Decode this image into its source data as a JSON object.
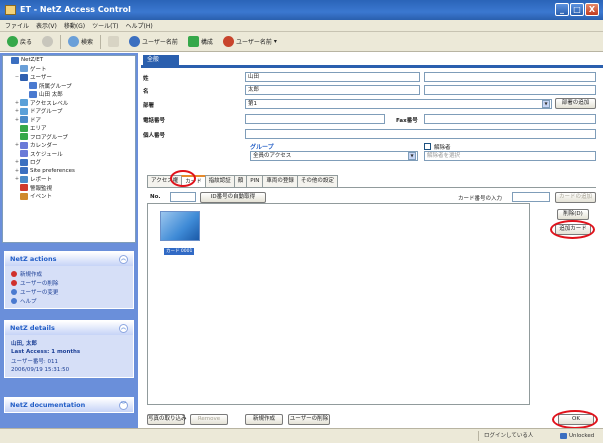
{
  "window": {
    "title": "ET - NetZ Access Control",
    "minimize": "_",
    "maximize": "□",
    "close": "X"
  },
  "menu": [
    "ファイル",
    "表示(V)",
    "移動(G)",
    "ツール(T)",
    "ヘルプ(H)"
  ],
  "toolbar": {
    "back": "戻る",
    "search": "検索",
    "users": "ユーザー名前",
    "members": "構成",
    "user_list": "ユーザー名前"
  },
  "tree": [
    {
      "level": 0,
      "exp": "",
      "icon": "#3b6fc0",
      "label": "NetZ/ET"
    },
    {
      "level": 1,
      "exp": "",
      "icon": "#6a9fd8",
      "label": "ゲート"
    },
    {
      "level": 1,
      "exp": "−",
      "icon": "#2e5fb0",
      "label": "ユーザー"
    },
    {
      "level": 2,
      "exp": "",
      "icon": "#4a7ad0",
      "label": "所属グループ"
    },
    {
      "level": 2,
      "exp": "",
      "icon": "#4a7ad0",
      "label": "山田 太郎"
    },
    {
      "level": 1,
      "exp": "+",
      "icon": "#5aa0d8",
      "label": "アクセスレベル"
    },
    {
      "level": 1,
      "exp": "+",
      "icon": "#5aa0d8",
      "label": "ドアグループ"
    },
    {
      "level": 1,
      "exp": "+",
      "icon": "#4a8ac8",
      "label": "ドア"
    },
    {
      "level": 1,
      "exp": "",
      "icon": "#36a84a",
      "label": "エリア"
    },
    {
      "level": 1,
      "exp": "",
      "icon": "#36a84a",
      "label": "フロアグループ"
    },
    {
      "level": 1,
      "exp": "+",
      "icon": "#6a7ad8",
      "label": "カレンダー"
    },
    {
      "level": 1,
      "exp": "",
      "icon": "#6a7ad8",
      "label": "スケジュール"
    },
    {
      "level": 1,
      "exp": "+",
      "icon": "#3b6fc0",
      "label": "ログ"
    },
    {
      "level": 1,
      "exp": "+",
      "icon": "#3b6fc0",
      "label": "Site preferences"
    },
    {
      "level": 1,
      "exp": "+",
      "icon": "#4a8ac8",
      "label": "レポート"
    },
    {
      "level": 1,
      "exp": "",
      "icon": "#d03a2c",
      "label": "警報監視"
    },
    {
      "level": 1,
      "exp": "",
      "icon": "#d08a2c",
      "label": "イベント"
    }
  ],
  "actions": {
    "title": "NetZ actions",
    "items": [
      {
        "icon": "#d0302c",
        "label": "新規作成"
      },
      {
        "icon": "#d0302c",
        "label": "ユーザーの削除"
      },
      {
        "icon": "#4a7ad0",
        "label": "ユーザーの変更"
      },
      {
        "icon": "#4a7ad0",
        "label": "ヘルプ"
      }
    ]
  },
  "details": {
    "title": "NetZ details",
    "name": "山田, 太郎",
    "last_access": "Last Access: 1 months",
    "rows": [
      "ユーザー番号: 011",
      "2006/09/19 15:31:50"
    ]
  },
  "documentation": {
    "title": "NetZ documentation"
  },
  "main": {
    "tab_label": "全般",
    "fields": {
      "last_name_label": "姓",
      "last_name": "山田",
      "first_name_label": "名",
      "first_name": "太郎",
      "dept_label": "部署",
      "dept_value": "第1",
      "dept_button": "部署の追加",
      "phone_label": "電話番号",
      "fax_label": "Fax番号",
      "mobile_label": "個人番号",
      "group_label": "グループ",
      "group_value": "全員のアクセス",
      "exempt_label": "解除者",
      "exempt_placeholder": "解除者を選択"
    },
    "tabs": [
      "アクセス権",
      "カード",
      "指紋認証",
      "顔",
      "PIN",
      "車両の登録",
      "その他の設定"
    ],
    "card": {
      "no_label": "No.",
      "read_button": "ID番号の自動取得",
      "card_no_label": "カード番号の入力",
      "card_no_value": "",
      "add_button": "カードの追加"
    },
    "side_buttons": {
      "delete": "削除(D)",
      "change": "追加カード"
    },
    "thumb_label": "カード 0001",
    "bottom_buttons": [
      "写真の取り込み",
      "Remove",
      "新規作成",
      "ユーザーの削除"
    ],
    "ok_button": "OK"
  },
  "status": {
    "center": "ログインしている人",
    "right": "Unlocked"
  }
}
